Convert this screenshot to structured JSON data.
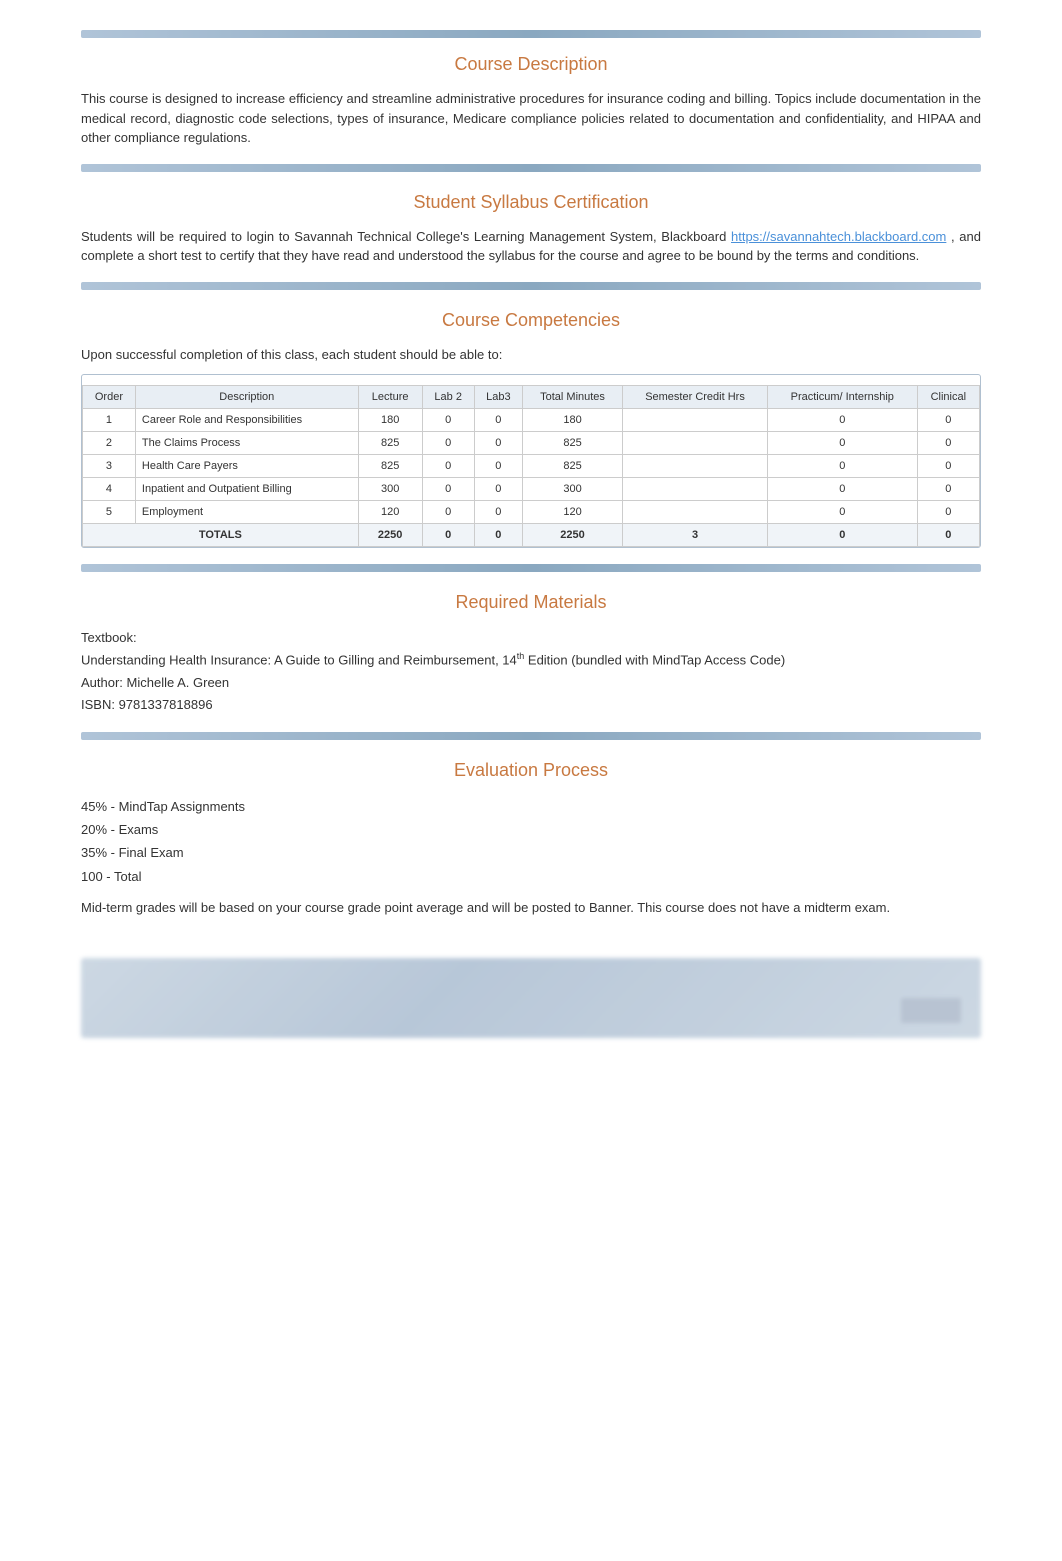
{
  "sections": {
    "course_description": {
      "title": "Course Description",
      "body": "This course is designed to increase efficiency and streamline administrative procedures for insurance coding and billing.  Topics include documentation in the medical record, diagnostic code selections, types of insurance, Medicare compliance policies related to documentation and confidentiality, and HIPAA and other compliance regulations."
    },
    "student_syllabus": {
      "title": "Student Syllabus Certification",
      "body_before": "Students will be required to login to Savannah Technical College's Learning Management System, Blackboard ",
      "link": "https://savannahtech.blackboard.com",
      "body_after": " , and complete a short test to certify that they have read and understood the syllabus for the course and agree to be bound by the terms and conditions."
    },
    "course_competencies": {
      "title": "Course Competencies",
      "intro": "Upon successful completion of this class, each student should be able to:",
      "table": {
        "headers": [
          "Order",
          "Description",
          "Lecture",
          "Lab 2",
          "Lab3",
          "Total Minutes",
          "Semester Credit Hrs",
          "Practicum/ Internship",
          "Clinical"
        ],
        "rows": [
          {
            "order": "1",
            "description": "Career Role and Responsibilities",
            "lecture": "180",
            "lab2": "0",
            "lab3": "0",
            "total_minutes": "180",
            "semester_credit": "",
            "practicum": "0",
            "clinical": "0"
          },
          {
            "order": "2",
            "description": "The Claims Process",
            "lecture": "825",
            "lab2": "0",
            "lab3": "0",
            "total_minutes": "825",
            "semester_credit": "",
            "practicum": "0",
            "clinical": "0"
          },
          {
            "order": "3",
            "description": "Health Care Payers",
            "lecture": "825",
            "lab2": "0",
            "lab3": "0",
            "total_minutes": "825",
            "semester_credit": "",
            "practicum": "0",
            "clinical": "0"
          },
          {
            "order": "4",
            "description": "Inpatient and Outpatient Billing",
            "lecture": "300",
            "lab2": "0",
            "lab3": "0",
            "total_minutes": "300",
            "semester_credit": "",
            "practicum": "0",
            "clinical": "0"
          },
          {
            "order": "5",
            "description": "Employment",
            "lecture": "120",
            "lab2": "0",
            "lab3": "0",
            "total_minutes": "120",
            "semester_credit": "",
            "practicum": "0",
            "clinical": "0"
          }
        ],
        "totals": {
          "label": "TOTALS",
          "lecture": "2250",
          "lab2": "0",
          "lab3": "0",
          "total_minutes": "2250",
          "semester_credit": "3",
          "practicum": "0",
          "clinical": "0"
        }
      }
    },
    "required_materials": {
      "title": "Required Materials",
      "textbook_label": "Textbook:",
      "book_title_before": "Understanding Health Insurance: A Guide to Gilling and Reimbursement, 14",
      "book_title_superscript": "th",
      "book_title_after": " Edition (bundled with MindTap Access Code)",
      "author": "Author: Michelle A. Green",
      "isbn": "ISBN: 9781337818896"
    },
    "evaluation_process": {
      "title": "Evaluation Process",
      "items": [
        "45% - MindTap Assignments",
        "20% - Exams",
        "35% - Final Exam",
        "100 - Total"
      ],
      "note": "Mid-term grades will be based on your course grade point average and will be posted to Banner. This course does not have a midterm exam."
    }
  }
}
